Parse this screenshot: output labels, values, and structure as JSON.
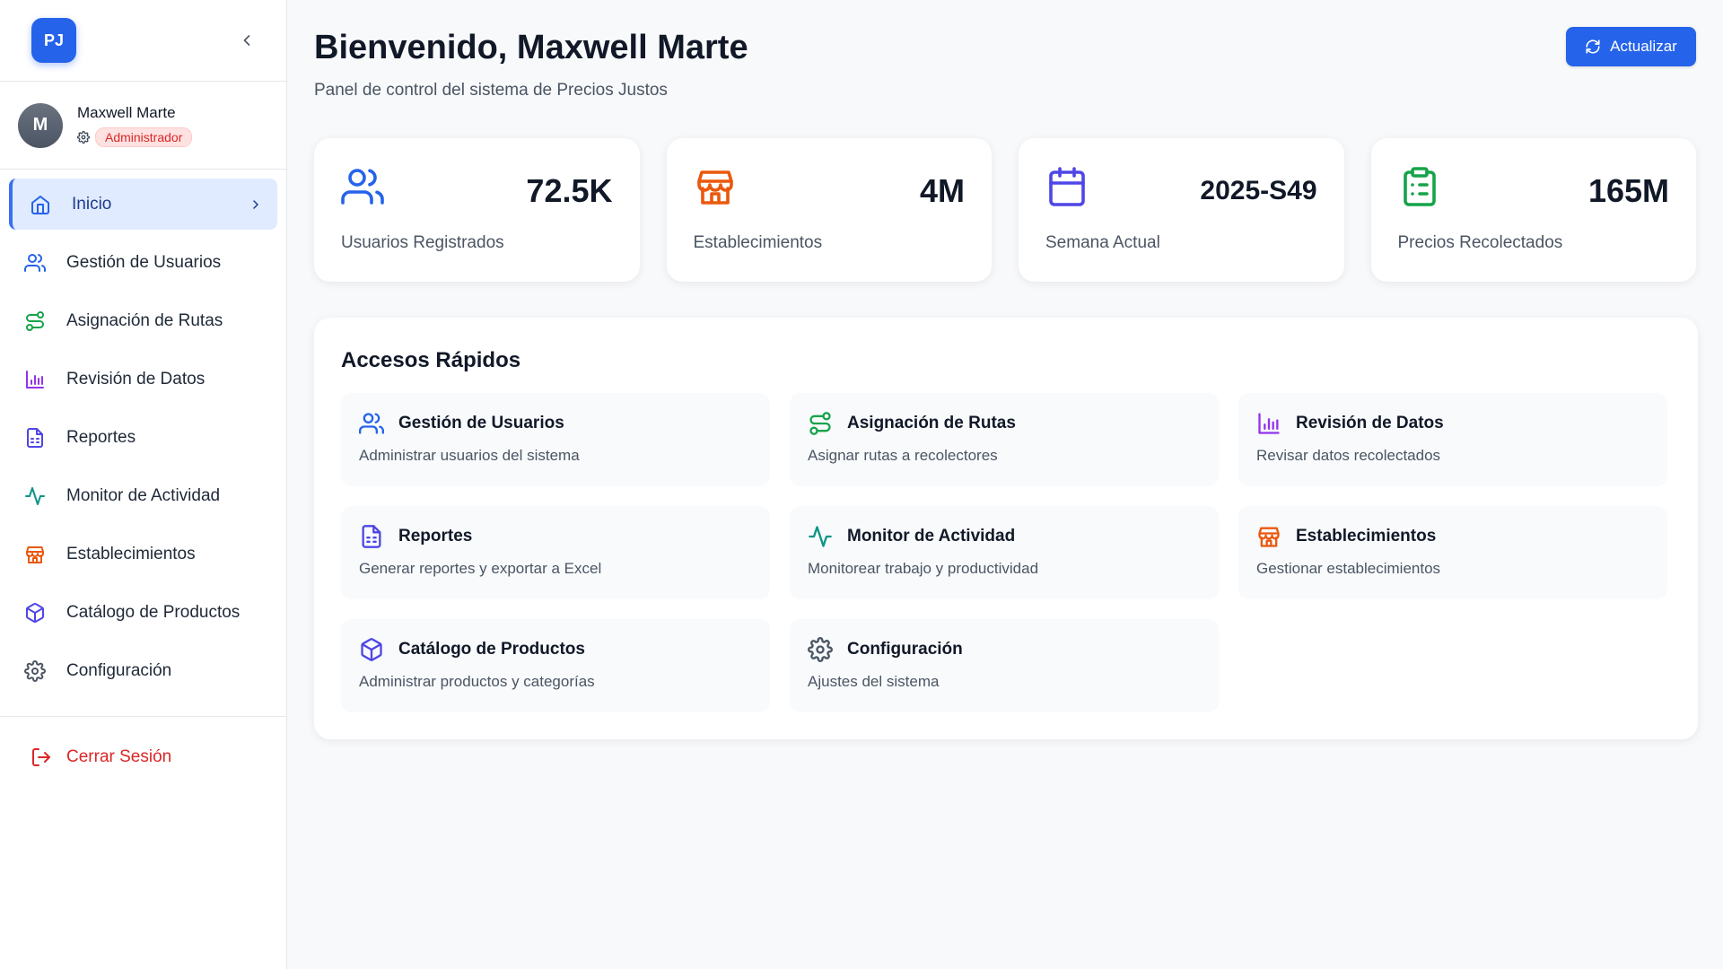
{
  "sidebar": {
    "logo_text": "PJ",
    "user": {
      "initial": "M",
      "name": "Maxwell Marte",
      "role": "Administrador"
    },
    "items": [
      {
        "label": "Inicio",
        "icon": "home-icon",
        "color": "#2563eb"
      },
      {
        "label": "Gestión de Usuarios",
        "icon": "users-icon",
        "color": "#2563eb"
      },
      {
        "label": "Asignación de Rutas",
        "icon": "route-icon",
        "color": "#16a34a"
      },
      {
        "label": "Revisión de Datos",
        "icon": "bar-chart-icon",
        "color": "#9333ea"
      },
      {
        "label": "Reportes",
        "icon": "file-text-icon",
        "color": "#4f46e5"
      },
      {
        "label": "Monitor de Actividad",
        "icon": "activity-icon",
        "color": "#0d9488"
      },
      {
        "label": "Establecimientos",
        "icon": "store-icon",
        "color": "#ea580c"
      },
      {
        "label": "Catálogo de Productos",
        "icon": "package-icon",
        "color": "#4f46e5"
      },
      {
        "label": "Configuración",
        "icon": "gear-icon",
        "color": "#4b5563"
      }
    ],
    "logout_label": "Cerrar Sesión"
  },
  "header": {
    "title": "Bienvenido, Maxwell Marte",
    "subtitle": "Panel de control del sistema de Precios Justos",
    "refresh_label": "Actualizar"
  },
  "stats": [
    {
      "value": "72.5K",
      "label": "Usuarios Registrados",
      "icon": "users-icon",
      "color": "#2563eb"
    },
    {
      "value": "4M",
      "label": "Establecimientos",
      "icon": "store-icon",
      "color": "#ea580c"
    },
    {
      "value": "2025-S49",
      "label": "Semana Actual",
      "icon": "calendar-icon",
      "color": "#4f46e5"
    },
    {
      "value": "165M",
      "label": "Precios Recolectados",
      "icon": "clipboard-icon",
      "color": "#16a34a"
    }
  ],
  "quick_access": {
    "title": "Accesos Rápidos",
    "items": [
      {
        "title": "Gestión de Usuarios",
        "desc": "Administrar usuarios del sistema",
        "icon": "users-icon"
      },
      {
        "title": "Asignación de Rutas",
        "desc": "Asignar rutas a recolectores",
        "icon": "route-icon"
      },
      {
        "title": "Revisión de Datos",
        "desc": "Revisar datos recolectados",
        "icon": "bar-chart-icon"
      },
      {
        "title": "Reportes",
        "desc": "Generar reportes y exportar a Excel",
        "icon": "file-text-icon"
      },
      {
        "title": "Monitor de Actividad",
        "desc": "Monitorear trabajo y productividad",
        "icon": "activity-icon"
      },
      {
        "title": "Establecimientos",
        "desc": "Gestionar establecimientos",
        "icon": "store-icon"
      },
      {
        "title": "Catálogo de Productos",
        "desc": "Administrar productos y categorías",
        "icon": "package-icon"
      },
      {
        "title": "Configuración",
        "desc": "Ajustes del sistema",
        "icon": "gear-icon"
      }
    ]
  }
}
